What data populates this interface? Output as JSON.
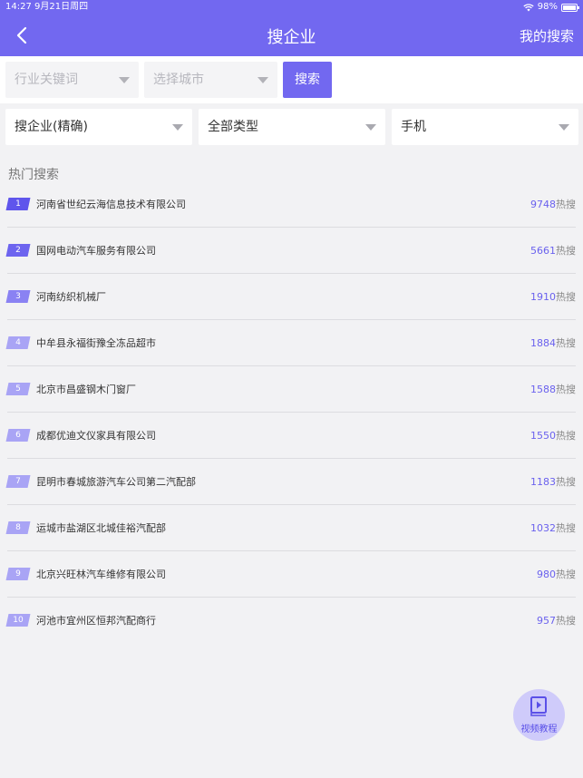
{
  "status": {
    "time": "14:27",
    "date": "9月21日周四",
    "battery": "98%",
    "battery_level": 0.98
  },
  "header": {
    "title": "搜企业",
    "right_label": "我的搜索"
  },
  "search": {
    "keyword_placeholder": "行业关键词",
    "city_placeholder": "选择城市",
    "button_label": "搜索"
  },
  "filters": {
    "mode": "搜企业(精确)",
    "type": "全部类型",
    "contact": "手机"
  },
  "hot": {
    "title": "热门搜索",
    "suffix": "热搜",
    "items": [
      {
        "rank": "1",
        "name": "河南省世纪云海信息技术有限公司",
        "count": "9748"
      },
      {
        "rank": "2",
        "name": "国网电动汽车服务有限公司",
        "count": "5661"
      },
      {
        "rank": "3",
        "name": "河南纺织机械厂",
        "count": "1910"
      },
      {
        "rank": "4",
        "name": "中牟县永福街豫全冻品超市",
        "count": "1884"
      },
      {
        "rank": "5",
        "name": "北京市昌盛钢木门窗厂",
        "count": "1588"
      },
      {
        "rank": "6",
        "name": "成都优迪文仪家具有限公司",
        "count": "1550"
      },
      {
        "rank": "7",
        "name": "昆明市春城旅游汽车公司第二汽配部",
        "count": "1183"
      },
      {
        "rank": "8",
        "name": "运城市盐湖区北城佳裕汽配部",
        "count": "1032"
      },
      {
        "rank": "9",
        "name": "北京兴旺林汽车维修有限公司",
        "count": "980"
      },
      {
        "rank": "10",
        "name": "河池市宜州区恒邦汽配商行",
        "count": "957"
      }
    ]
  },
  "fab": {
    "label": "视频教程"
  },
  "colors": {
    "accent": "#7268f0",
    "background": "#f2f2f4"
  }
}
